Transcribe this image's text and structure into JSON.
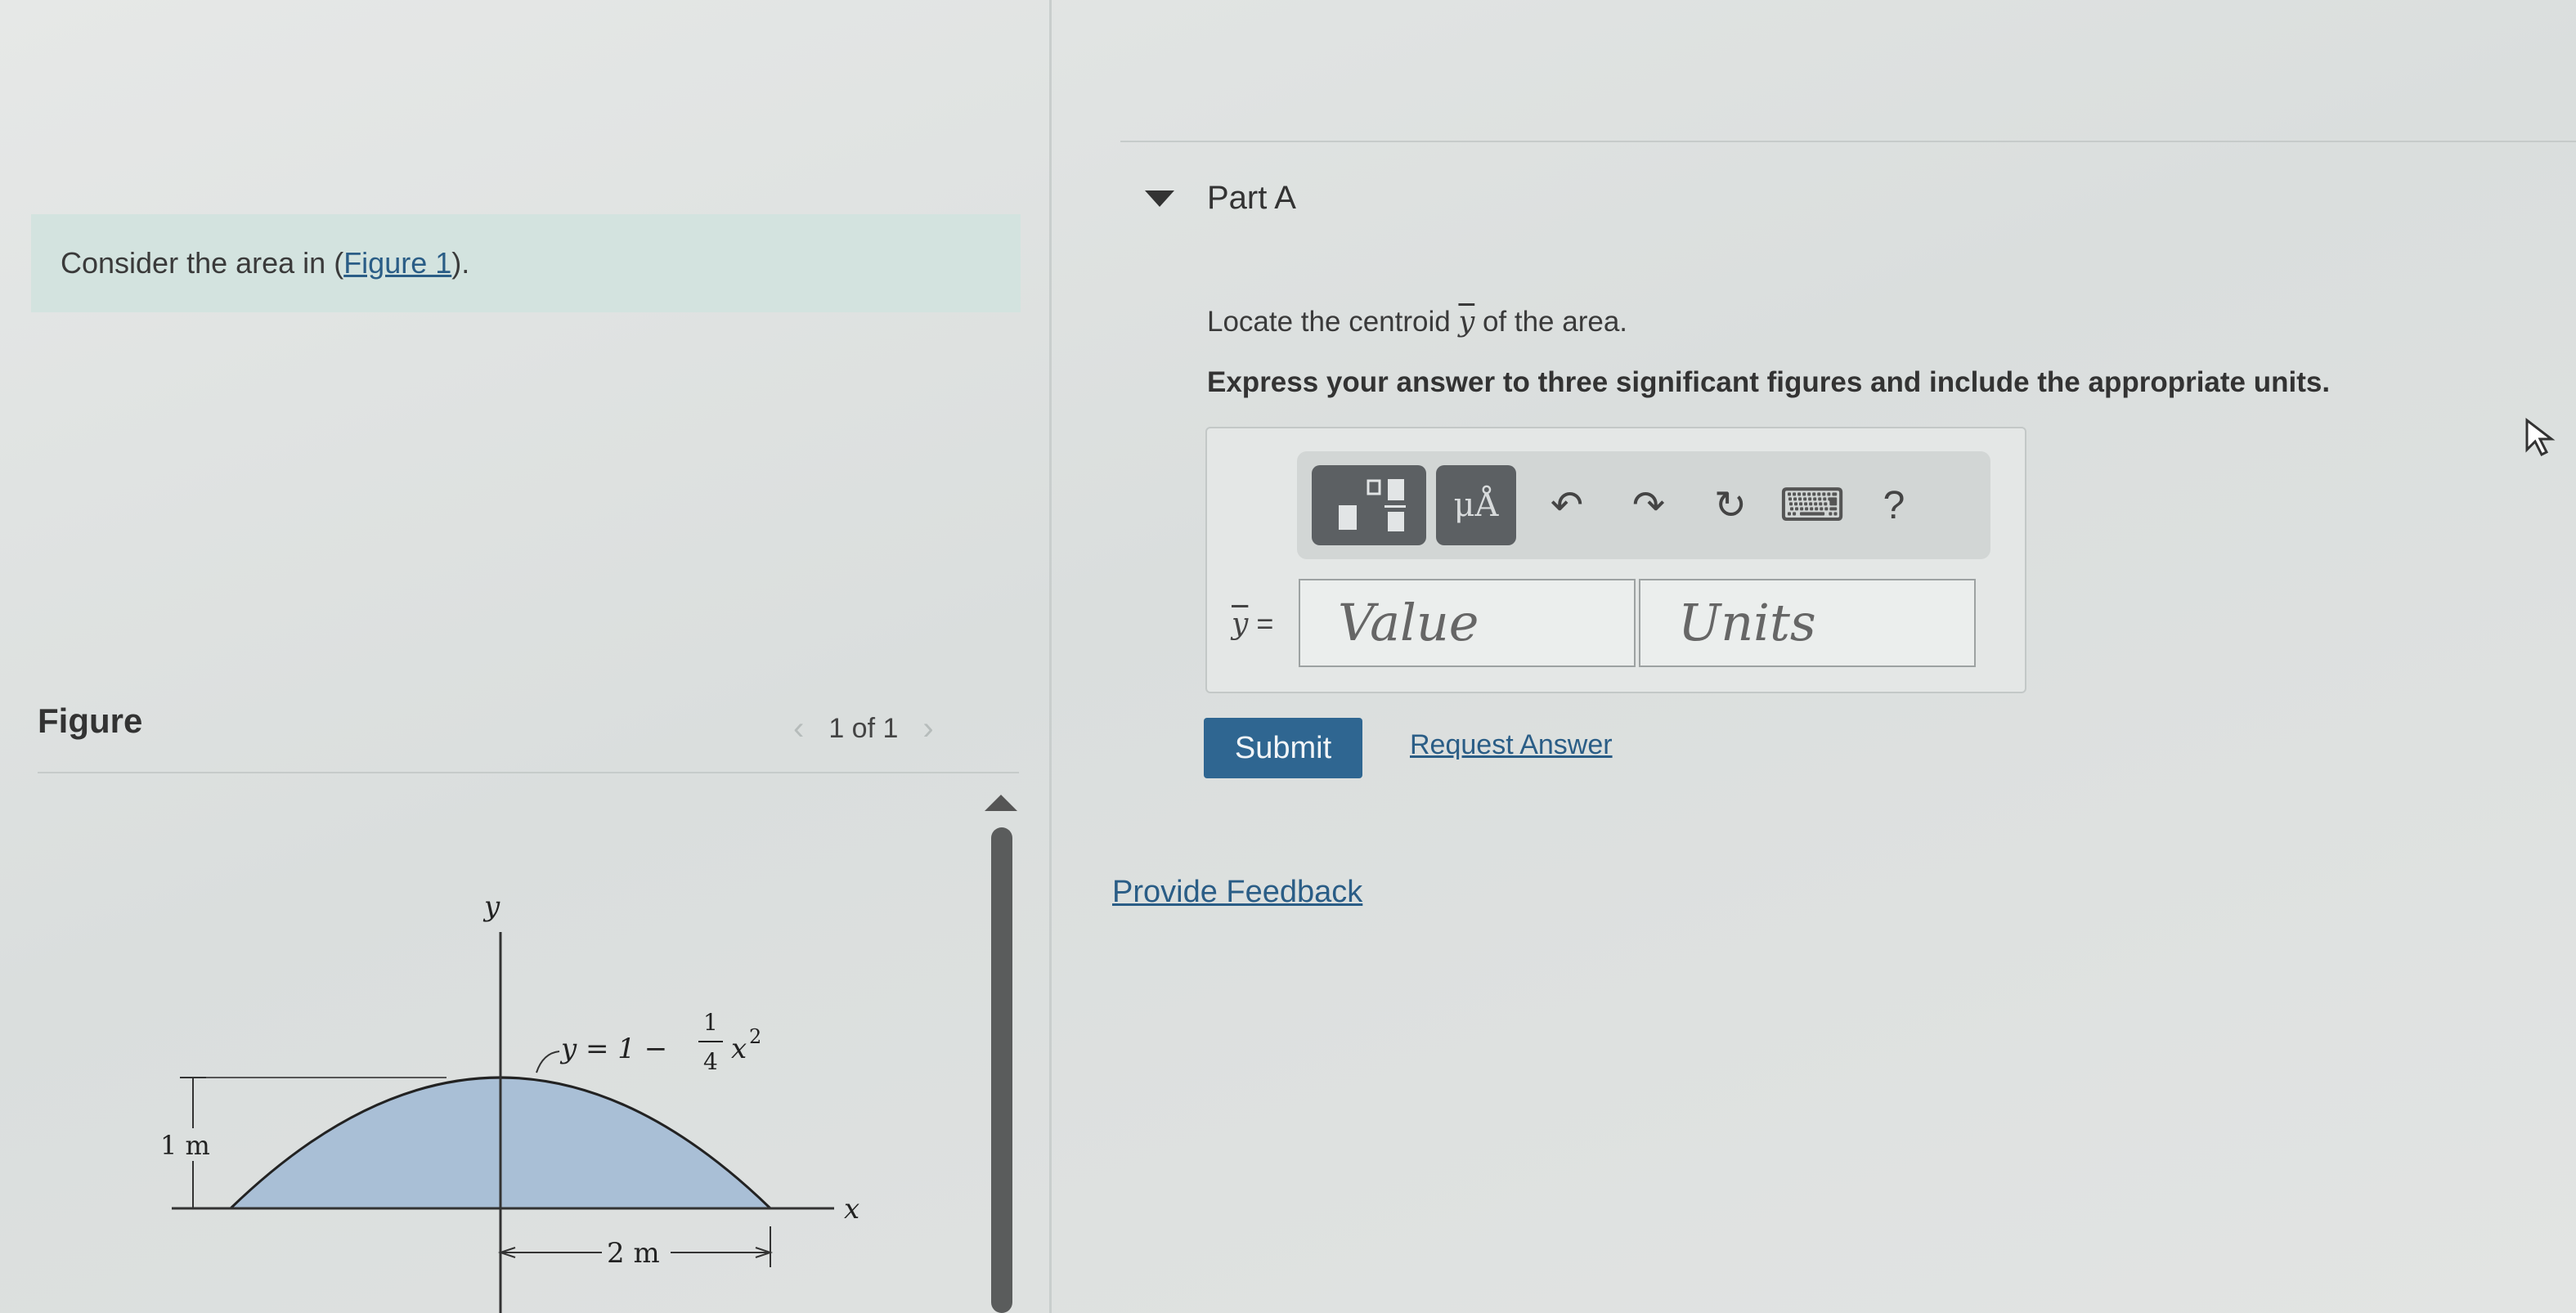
{
  "problem": {
    "intro_text": "Consider the area in (",
    "figure_link": "Figure 1",
    "intro_end": ")."
  },
  "figure_panel": {
    "label": "Figure",
    "page_indicator": "1 of 1",
    "prev_icon": "chevron-left-icon",
    "next_icon": "chevron-right-icon",
    "diagram": {
      "y_axis_label": "y",
      "x_axis_label": "x",
      "curve_label_lhs": "y = 1 −",
      "curve_label_frac_num": "1",
      "curve_label_frac_den": "4",
      "curve_label_rhs": "x",
      "curve_label_exp": "2",
      "height_dim": "1 m",
      "width_dim": "2 m",
      "fill_color": "#a9bfd6"
    }
  },
  "part": {
    "title": "Part A",
    "question_pre": "Locate the centroid ",
    "question_symbol": "y",
    "question_post": " of the area.",
    "instruction": "Express your answer to three significant figures and include the appropriate units."
  },
  "toolbar": {
    "templates_icon": "fraction-template-icon",
    "units_label": "μÅ",
    "undo_icon": "undo-icon",
    "redo_icon": "redo-icon",
    "reset_icon": "reset-icon",
    "keyboard_icon": "keyboard-icon",
    "help_label": "?"
  },
  "answer": {
    "symbol": "y",
    "equals": " =",
    "value_placeholder": "Value",
    "units_placeholder": "Units"
  },
  "actions": {
    "submit_label": "Submit",
    "request_label": "Request Answer",
    "feedback_label": "Provide Feedback"
  },
  "colors": {
    "accent": "#2f6691",
    "link": "#2a5d86",
    "intro_bg": "#d3e3df"
  }
}
